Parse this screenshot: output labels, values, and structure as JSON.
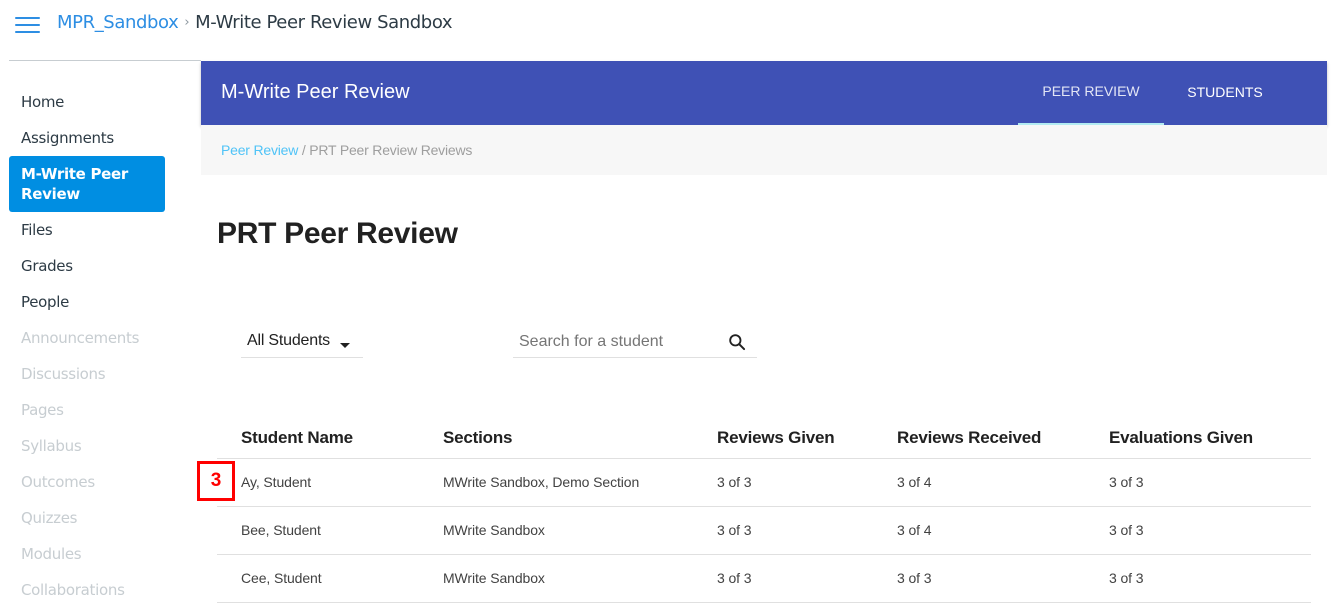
{
  "topbar": {
    "menu_icon": "hamburger-icon",
    "course_link": "MPR_Sandbox",
    "separator": "›",
    "current_page": "M-Write Peer Review Sandbox"
  },
  "sidebar": {
    "items": [
      {
        "label": "Home",
        "state": "enabled"
      },
      {
        "label": "Assignments",
        "state": "enabled"
      },
      {
        "label": "M-Write Peer Review",
        "state": "active"
      },
      {
        "label": "Files",
        "state": "enabled"
      },
      {
        "label": "Grades",
        "state": "enabled"
      },
      {
        "label": "People",
        "state": "enabled"
      },
      {
        "label": "Announcements",
        "state": "disabled"
      },
      {
        "label": "Discussions",
        "state": "disabled"
      },
      {
        "label": "Pages",
        "state": "disabled"
      },
      {
        "label": "Syllabus",
        "state": "disabled"
      },
      {
        "label": "Outcomes",
        "state": "disabled"
      },
      {
        "label": "Quizzes",
        "state": "disabled"
      },
      {
        "label": "Modules",
        "state": "disabled"
      },
      {
        "label": "Collaborations",
        "state": "disabled"
      }
    ]
  },
  "app_header": {
    "title": "M-Write Peer Review",
    "tabs": [
      {
        "label": "PEER REVIEW",
        "active": true
      },
      {
        "label": "STUDENTS",
        "active": false
      }
    ],
    "color": "#3f51b5",
    "indicator_color": "#b2ebf2"
  },
  "sub_breadcrumb": {
    "link": "Peer Review",
    "separator": " / ",
    "current": "PRT Peer Review Reviews"
  },
  "page_title": "PRT Peer Review",
  "filters": {
    "student_filter": {
      "selected": "All Students"
    },
    "search": {
      "placeholder": "Search for a student",
      "value": ""
    }
  },
  "table": {
    "headers": [
      "Student Name",
      "Sections",
      "Reviews Given",
      "Reviews Received",
      "Evaluations Given"
    ],
    "rows": [
      [
        "Ay, Student",
        "MWrite Sandbox, Demo Section",
        "3 of 3",
        "3 of 4",
        "3 of 3"
      ],
      [
        "Bee, Student",
        "MWrite Sandbox",
        "3 of 3",
        "3 of 4",
        "3 of 3"
      ],
      [
        "Cee, Student",
        "MWrite Sandbox",
        "3 of 3",
        "3 of 3",
        "3 of 3"
      ]
    ]
  },
  "annotation_badge": {
    "text": "3",
    "color": "#ff0000"
  }
}
